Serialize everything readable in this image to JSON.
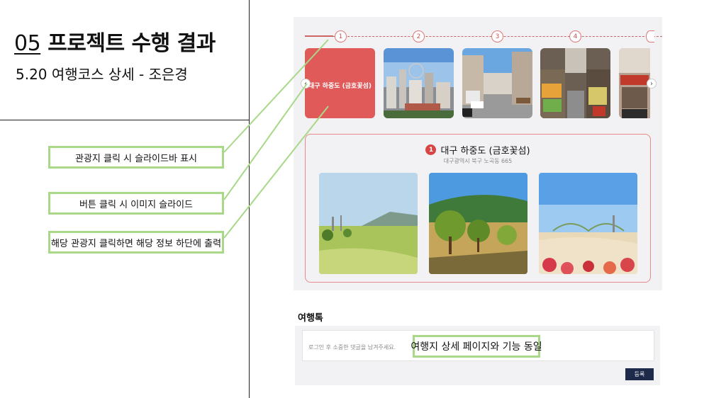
{
  "slide": {
    "number": "05",
    "title": "프로젝트 수행 결과",
    "subtitle": "5.20 여행코스 상세 - 조은경"
  },
  "callouts": {
    "slider_bar": "관광지 클릭 시 슬라이드바 표시",
    "image_slide": "버튼 클릭 시 이미지 슬라이드",
    "detail_info": "해당 관광지 클릭하면 해당 정보 하단에 출력",
    "same_feature": "여행지 상세 페이지와 기능 동일"
  },
  "course": {
    "steps": [
      "1",
      "2",
      "3",
      "4"
    ],
    "selected_caption": "대구 하중도 (금호꽃섬)",
    "prev_icon": "chevron-left-icon",
    "next_icon": "chevron-right-icon",
    "selected_color": "#e05a5a"
  },
  "detail": {
    "badge": "1",
    "name": "대구 하중도 (금호꽃섬)",
    "address": "대구광역시 북구 노곡동 665"
  },
  "comments": {
    "section_title": "여행톡",
    "placeholder": "로그인 후 소중한 댓글을 남겨주세요.",
    "submit_label": "등록",
    "submit_color": "#1e2a4a"
  },
  "accent_colors": {
    "callout_border": "#a8d888",
    "panel_border": "#e68a8a"
  }
}
